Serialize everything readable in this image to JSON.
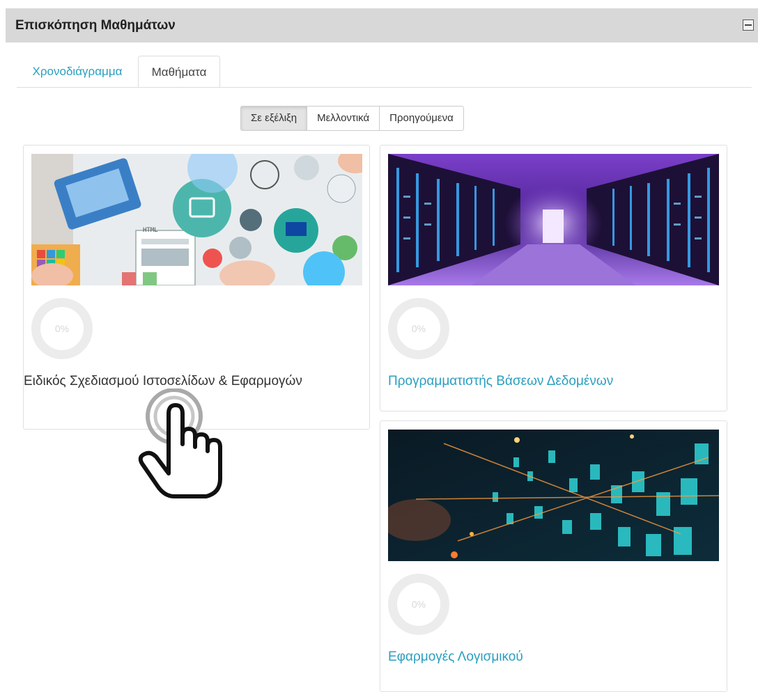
{
  "block": {
    "title": "Επισκόπηση Μαθημάτων",
    "collapse_icon": "minus-square-icon"
  },
  "tabs": [
    {
      "label": "Χρονοδιάγραμμα",
      "active": false
    },
    {
      "label": "Μαθήματα",
      "active": true
    }
  ],
  "filter": {
    "options": [
      "Σε εξέλιξη",
      "Μελλοντικά",
      "Προηγούμενα"
    ],
    "selected": "Σε εξέλιξη"
  },
  "courses": [
    {
      "name": "Ειδικός Σχεδιασμού Ιστοσελίδων & Εφαρμογών",
      "progress_label": "0%",
      "progress": 0,
      "image": "web-design-illustration"
    },
    {
      "name": "Προγραμματιστής Βάσεων Δεδομένων",
      "progress_label": "0%",
      "progress": 0,
      "image": "server-room"
    },
    {
      "name": "Εφαρμογές Λογισμικού",
      "progress_label": "0%",
      "progress": 0,
      "image": "binary-data-streams"
    }
  ],
  "overlay": {
    "cursor_icon": "hand-pointer-icon"
  },
  "colors": {
    "link": "#2a9fbf",
    "header_bg": "#d8d8d8"
  }
}
